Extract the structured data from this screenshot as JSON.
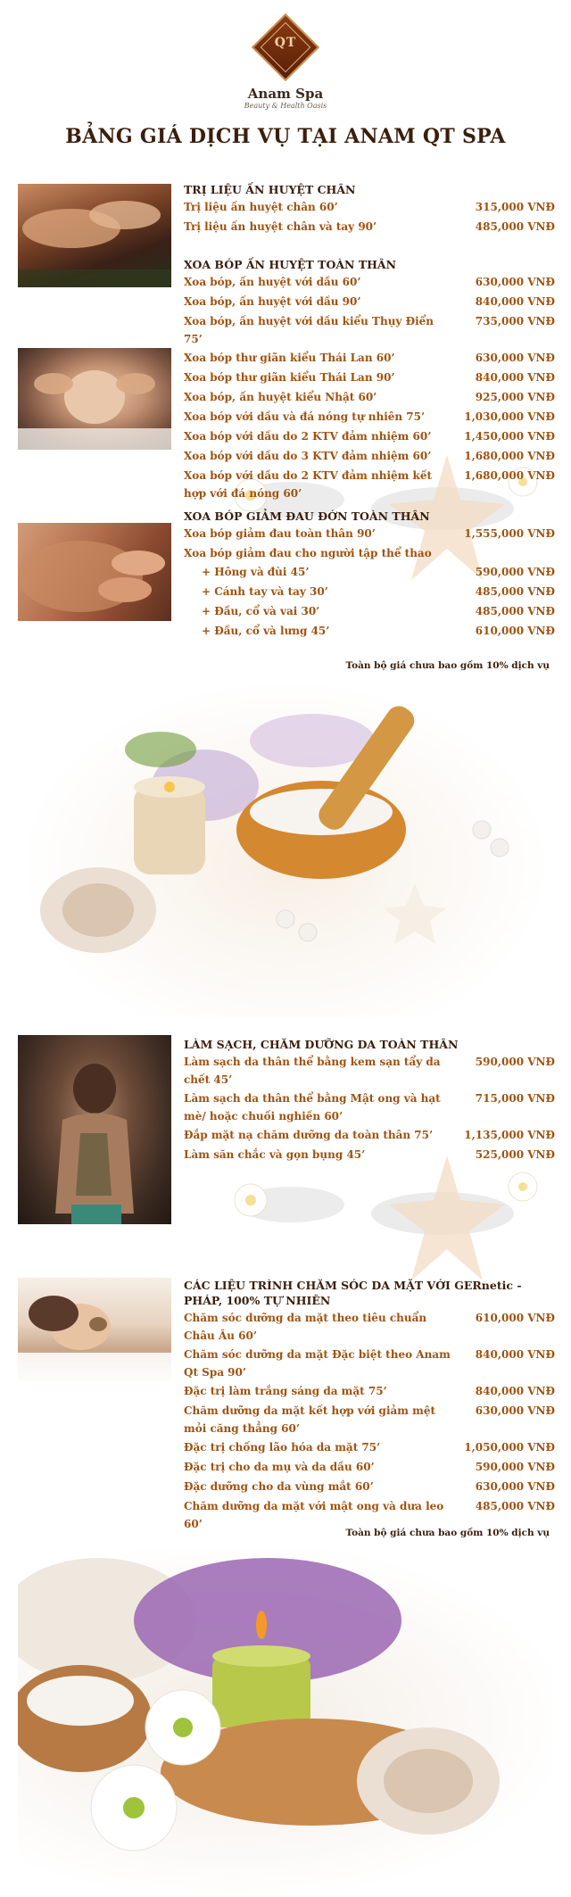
{
  "header": {
    "logo_text": "QT",
    "brand": "Anam Spa",
    "tagline": "Beauty & Health Oasis",
    "title": "BẢNG GIÁ DỊCH VỤ TẠI ANAM QT SPA"
  },
  "sections": [
    {
      "title": "TRỊ LIỆU ẤN HUYỆT CHÂN",
      "items": [
        {
          "name": "Trị liệu ấn huyệt chân 60’",
          "price": "315,000 VNĐ"
        },
        {
          "name": "Trị liệu ấn huyệt chân và tay 90’",
          "price": "485,000 VNĐ"
        }
      ]
    },
    {
      "title": "XOA BÓP ẤN HUYỆT TOÀN THÂN",
      "items": [
        {
          "name": "Xoa bóp, ấn huyệt với dầu 60’",
          "price": "630,000 VNĐ"
        },
        {
          "name": "Xoa bóp, ấn huyệt với dầu 90’",
          "price": "840,000 VNĐ"
        },
        {
          "name": "Xoa bóp, ấn huyệt với dầu kiểu Thụy Điển 75’",
          "price": "735,000 VNĐ"
        },
        {
          "name": "Xoa bóp thư giãn kiểu Thái Lan 60’",
          "price": "630,000 VNĐ"
        },
        {
          "name": "Xoa bóp thư giãn kiểu Thái Lan 90’",
          "price": "840,000 VNĐ"
        },
        {
          "name": "Xoa bóp, ấn huyệt kiểu Nhật 60’",
          "price": "925,000 VNĐ"
        },
        {
          "name": "Xoa bóp với dầu và đá nóng tự nhiên 75’",
          "price": "1,030,000 VNĐ"
        },
        {
          "name": "Xoa bóp với dầu do 2 KTV đảm nhiệm 60’",
          "price": "1,450,000 VNĐ"
        },
        {
          "name": "Xoa bóp với dầu do 3 KTV đảm nhiệm 60’",
          "price": "1,680,000 VNĐ"
        },
        {
          "name": "Xoa bóp với dầu do 2 KTV đảm nhiệm kết hợp với đá nóng 60’",
          "price": "1,680,000 VNĐ"
        }
      ]
    },
    {
      "title": "XOA BÓP GIẢM ĐAU ĐỚN TOÀN THÂN",
      "items": [
        {
          "name": "Xoa bóp giảm đau toàn thân 90’",
          "price": "1,555,000 VNĐ"
        },
        {
          "name": "Xoa bóp giảm đau cho người tập thể thao",
          "price": ""
        },
        {
          "name": "+ Hông và đùi 45’",
          "price": "590,000 VNĐ"
        },
        {
          "name": "+ Cánh tay và tay 30’",
          "price": "485,000 VNĐ"
        },
        {
          "name": "+ Đầu, cổ và vai 30’",
          "price": "485,000 VNĐ"
        },
        {
          "name": "+ Đầu, cổ và lưng 45’",
          "price": "610,000 VNĐ"
        }
      ]
    },
    {
      "title": "LÀM SẠCH, CHĂM DƯỠNG DA TOÀN THÂN",
      "items": [
        {
          "name": "Làm sạch da thân thể bằng kem sạn tẩy da chết 45’",
          "price": "590,000 VNĐ"
        },
        {
          "name": "Làm sạch da thân thể bằng Mật ong và hạt mè/ hoặc chuối nghiền 60’",
          "price": "715,000 VNĐ"
        },
        {
          "name": "Đắp mặt nạ chăm dưỡng da toàn thân 75’",
          "price": "1,135,000 VNĐ"
        },
        {
          "name": "Làm săn chắc và gọn bụng 45’",
          "price": "525,000 VNĐ"
        }
      ]
    },
    {
      "title": "CÁC LIỆU TRÌNH CHĂM SÓC DA MẶT VỚI GERnetic - PHÁP, 100% TỰ NHIÊN",
      "items": [
        {
          "name": "Chăm sóc dưỡng da mặt theo tiêu chuẩn Châu Âu 60’",
          "price": "610,000 VNĐ"
        },
        {
          "name": "Chăm sóc dưỡng da mặt Đặc biệt theo Anam Qt Spa 90’",
          "price": "840,000 VNĐ"
        },
        {
          "name": "Đặc trị làm trắng sáng da mặt 75’",
          "price": "840,000 VNĐ"
        },
        {
          "name": "Chăm dưỡng da mặt kết hợp với giảm mệt mỏi căng thẳng 60’",
          "price": "630,000 VNĐ"
        },
        {
          "name": "Đặc trị chống lão hóa da mặt 75’",
          "price": "1,050,000 VNĐ"
        },
        {
          "name": "Đặc trị cho da mụ và da dầu 60’",
          "price": "590,000 VNĐ"
        },
        {
          "name": "Đặc dưỡng cho da vùng mắt 60’",
          "price": "630,000 VNĐ"
        },
        {
          "name": "Chăm dưỡng da mặt với mật ong và dưa leo 60’",
          "price": "485,000 VNĐ"
        }
      ]
    }
  ],
  "notes": {
    "service_note_1": "Toàn bộ giá chưa bao gồm 10% dịch vụ",
    "service_note_2": "Toàn bộ giá chưa bao gồm 10% dịch vụ"
  }
}
